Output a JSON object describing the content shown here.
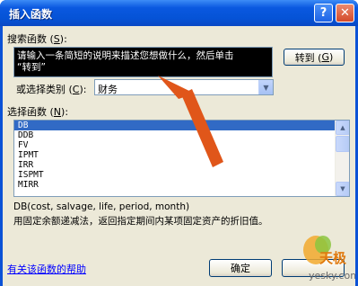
{
  "window": {
    "title": "插入函数"
  },
  "titlebar": {
    "help_glyph": "?",
    "close_glyph": "✕"
  },
  "search": {
    "label_prefix": "搜索函数 (",
    "label_key": "S",
    "label_suffix": "):",
    "line1": "请输入一条简短的说明来描述您想做什么，然后单击",
    "line2": "“转到”",
    "go_button": {
      "label_prefix": "转到 (",
      "key": "G",
      "label_suffix": ")"
    }
  },
  "category": {
    "label_prefix": "或选择类别 (",
    "label_key": "C",
    "label_suffix": "):",
    "value": "财务"
  },
  "function_list": {
    "label_prefix": "选择函数 (",
    "label_key": "N",
    "label_suffix": "):",
    "items": [
      "DB",
      "DDB",
      "FV",
      "IPMT",
      "IRR",
      "ISPMT",
      "MIRR"
    ],
    "selected": "DB"
  },
  "description": {
    "signature": "DB(cost, salvage, life, period, month)",
    "text": "用固定余额递减法，返回指定期间内某项固定资产的折旧值。"
  },
  "footer": {
    "help_link": "有关该函数的帮助",
    "ok_button": "确定"
  },
  "watermark": {
    "brand": "天极",
    "site": "yesky.com"
  },
  "colors": {
    "arrow": "#e0561a",
    "selection": "#316ac5",
    "titlebar": "#0553d6"
  }
}
